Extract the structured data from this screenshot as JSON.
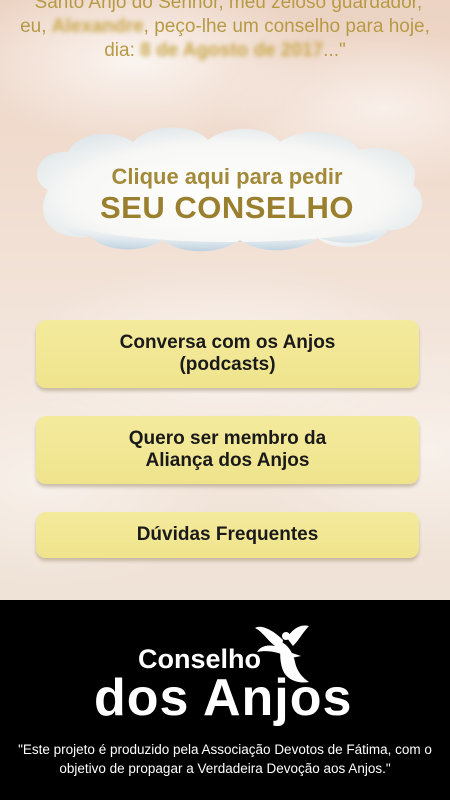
{
  "prayer": {
    "part1": "\"Santo Anjo do Senhor, meu zeloso guardador, eu, ",
    "name": "Alexandre",
    "part2": ", peço-lhe um conselho para hoje, dia: ",
    "date": "8 de Agosto de 2017",
    "ending": "...\""
  },
  "cloud_button": {
    "line1": "Clique aqui para pedir",
    "line2": "SEU CONSELHO"
  },
  "menu": {
    "podcasts": {
      "line1": "Conversa com os Anjos",
      "line2": "(podcasts)"
    },
    "membro": {
      "line1": "Quero ser membro da",
      "line2": "Aliança dos Anjos"
    },
    "duvidas": {
      "line1": "Dúvidas Frequentes"
    }
  },
  "footer": {
    "logo_top": "Conselho",
    "logo_bottom": "dos Anjos",
    "note": "\"Este projeto é produzido pela Associação Devotos de Fátima, com o objetivo de propagar a Verdadeira Devoção aos Anjos.\""
  },
  "colors": {
    "button_bg": "#f0e58f",
    "gold_text": "#b79a45",
    "footer_bg": "#000000"
  }
}
